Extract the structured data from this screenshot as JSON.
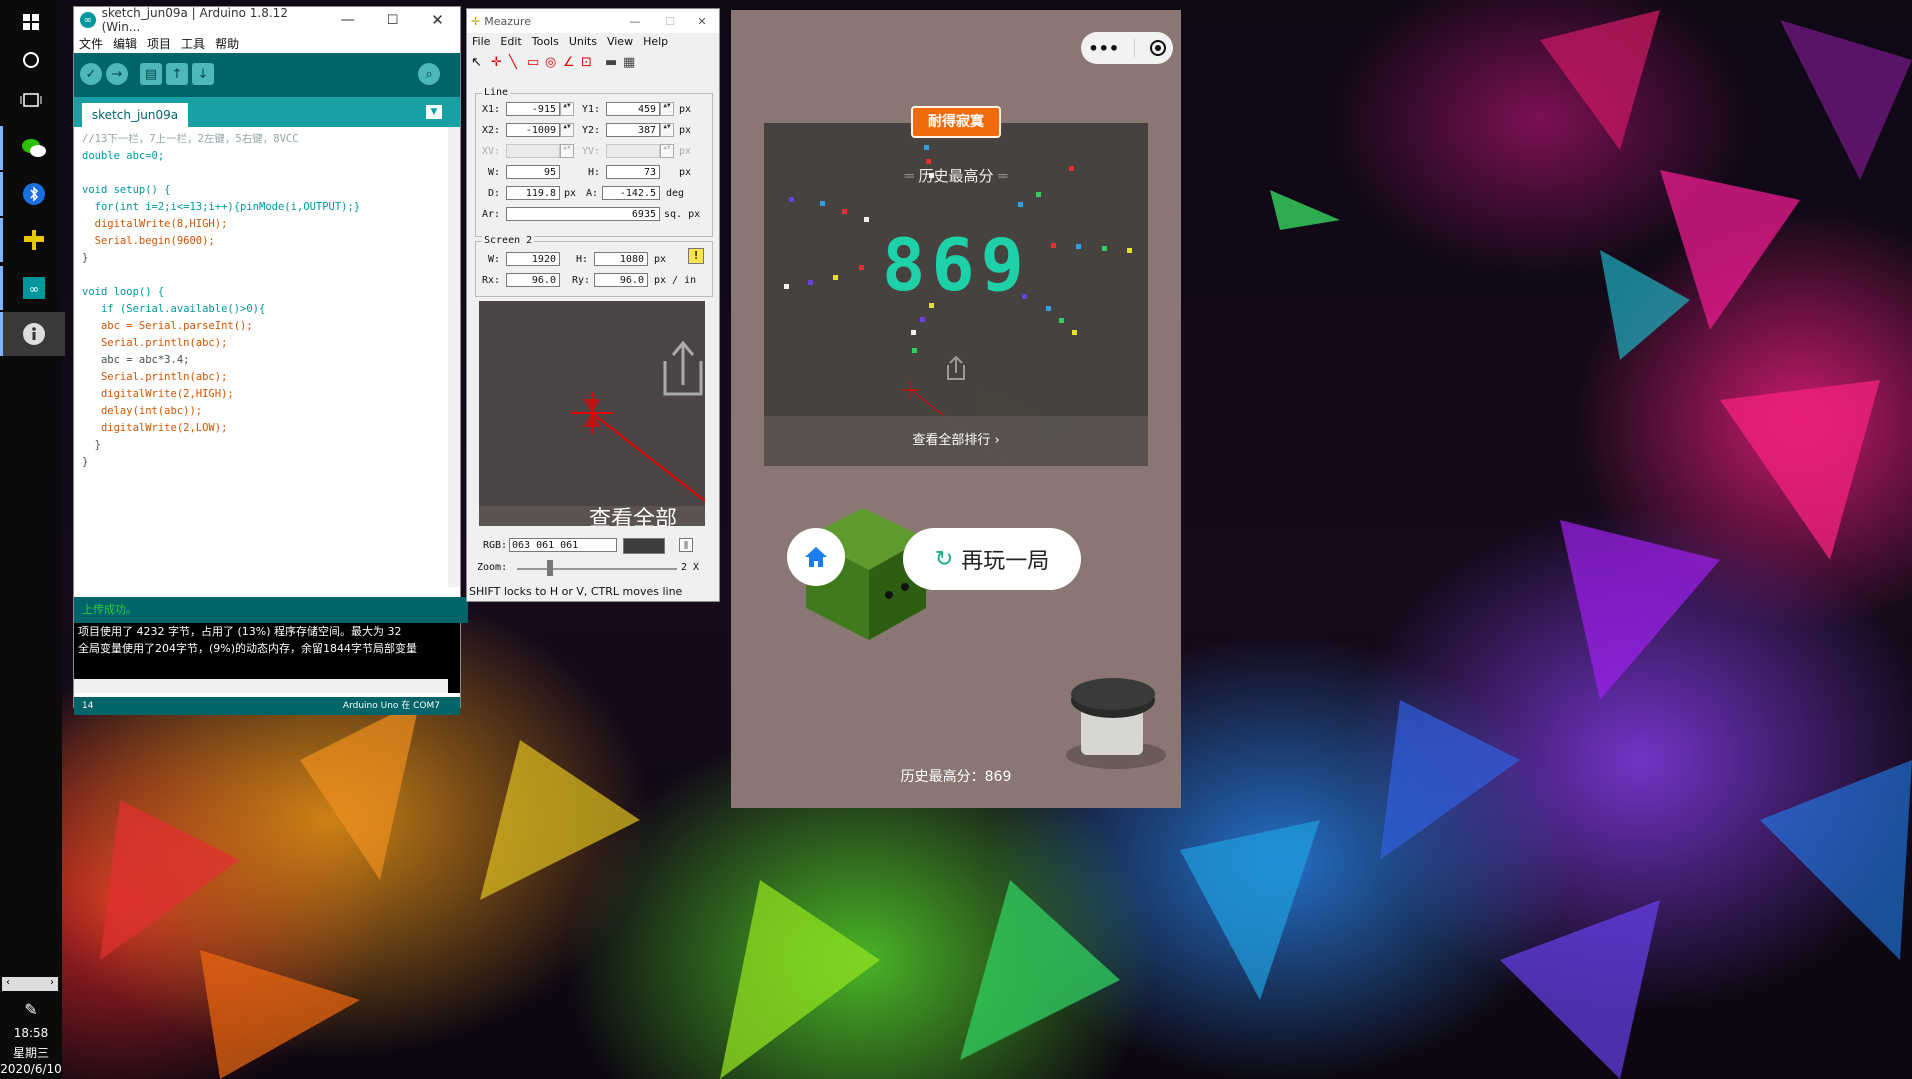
{
  "taskbar": {
    "time": "18:58",
    "weekday": "星期三",
    "date": "2020/6/10",
    "apps": [
      "windows-start-icon",
      "cortana-icon",
      "task-view-icon",
      "wechat-icon",
      "bluetooth-app-icon",
      "meazure-icon",
      "arduino-icon",
      "info-icon"
    ]
  },
  "arduino": {
    "title": "sketch_jun09a | Arduino 1.8.12 (Win...",
    "menu": [
      "文件",
      "编辑",
      "项目",
      "工具",
      "帮助"
    ],
    "tab": "sketch_jun09a",
    "code_lines": [
      "//13下一栏，7上一栏，2左键，5右键，8VCC",
      "double abc=0;",
      "",
      "void setup() {",
      "  for(int i=2;i<=13;i++){pinMode(i,OUTPUT);}",
      "  digitalWrite(8,HIGH);",
      "  Serial.begin(9600);",
      "}",
      "",
      "void loop() {",
      "   if (Serial.available()>0){",
      "   abc = Serial.parseInt();",
      "   Serial.println(abc);",
      "   abc = abc*3.4;",
      "   Serial.println(abc);",
      "   digitalWrite(2,HIGH);",
      "   delay(int(abc));",
      "   digitalWrite(2,LOW);",
      "  }",
      "}"
    ],
    "status": "上传成功。",
    "console_lines": [
      "项目使用了 4232 字节，占用了 (13%) 程序存储空间。最大为 32",
      "全局变量使用了204字节，(9%)的动态内存，余留1844字节局部变量"
    ],
    "footer_line": "14",
    "footer_board": "Arduino Uno 在 COM7"
  },
  "meazure": {
    "title": "Meazure",
    "menu": [
      "File",
      "Edit",
      "Tools",
      "Units",
      "View",
      "Help"
    ],
    "line_group": "Line",
    "x1_label": "X1:",
    "x1": "-915",
    "y1_label": "Y1:",
    "y1": "459",
    "x2_label": "X2:",
    "x2": "-1009",
    "y2_label": "Y2:",
    "y2": "387",
    "xv_label": "XV:",
    "yv_label": "YV:",
    "w_label": "W:",
    "w": "95",
    "h_label": "H:",
    "h": "73",
    "d_label": "D:",
    "d": "119.8",
    "a_label": "A:",
    "a": "-142.5",
    "ar_label": "Ar:",
    "ar": "6935",
    "unit_px": "px",
    "unit_deg": "deg",
    "unit_sqpx": "sq. px",
    "screen_group": "Screen 2",
    "sw_label": "W:",
    "sw": "1920",
    "sh_label": "H:",
    "sh": "1080",
    "rx_label": "Rx:",
    "rx": "96.0",
    "ry_label": "Ry:",
    "ry": "96.0",
    "res_unit": "px / in",
    "mag_text": "查看全部",
    "rgb_label": "RGB:",
    "rgb": "063 061 061",
    "zoom_label": "Zoom:",
    "zoom": "2 X",
    "hint": "SHIFT locks to H or V, CTRL moves line"
  },
  "game": {
    "badge": "耐得寂寞",
    "best_title": "历史最高分",
    "score": "869",
    "view_all": "查看全部排行",
    "replay": "再玩一局",
    "best_footer": "历史最高分：869",
    "score_color": "#1fd1a8",
    "badge_color": "#f06a0c"
  }
}
